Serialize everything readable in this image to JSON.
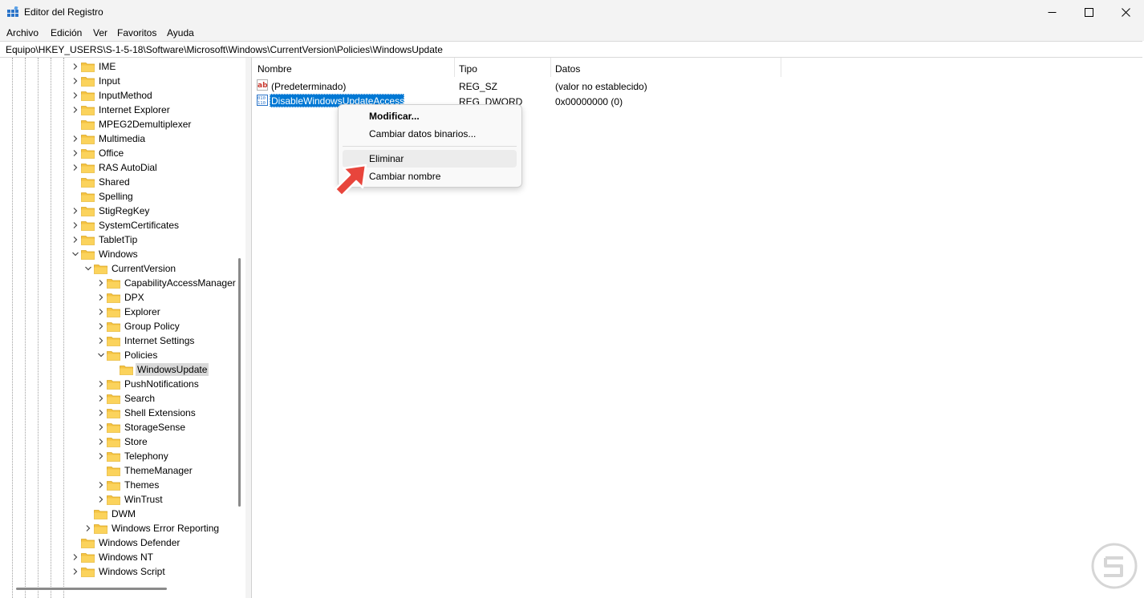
{
  "window": {
    "title": "Editor del Registro",
    "controls": [
      "minimize",
      "maximize",
      "close"
    ]
  },
  "menubar": {
    "items": [
      "Archivo",
      "Edición",
      "Ver",
      "Favoritos",
      "Ayuda"
    ]
  },
  "address": {
    "path": "Equipo\\HKEY_USERS\\S-1-5-18\\Software\\Microsoft\\Windows\\CurrentVersion\\Policies\\WindowsUpdate"
  },
  "tree": {
    "nodes": [
      {
        "label": "IME",
        "level": 0,
        "expander": "collapsed"
      },
      {
        "label": "Input",
        "level": 0,
        "expander": "collapsed"
      },
      {
        "label": "InputMethod",
        "level": 0,
        "expander": "collapsed"
      },
      {
        "label": "Internet Explorer",
        "level": 0,
        "expander": "collapsed"
      },
      {
        "label": "MPEG2Demultiplexer",
        "level": 0,
        "expander": "none"
      },
      {
        "label": "Multimedia",
        "level": 0,
        "expander": "collapsed"
      },
      {
        "label": "Office",
        "level": 0,
        "expander": "collapsed"
      },
      {
        "label": "RAS AutoDial",
        "level": 0,
        "expander": "collapsed"
      },
      {
        "label": "Shared",
        "level": 0,
        "expander": "none"
      },
      {
        "label": "Spelling",
        "level": 0,
        "expander": "none"
      },
      {
        "label": "StigRegKey",
        "level": 0,
        "expander": "collapsed"
      },
      {
        "label": "SystemCertificates",
        "level": 0,
        "expander": "collapsed"
      },
      {
        "label": "TabletTip",
        "level": 0,
        "expander": "collapsed"
      },
      {
        "label": "Windows",
        "level": 0,
        "expander": "expanded"
      },
      {
        "label": "CurrentVersion",
        "level": 1,
        "expander": "expanded"
      },
      {
        "label": "CapabilityAccessManager",
        "level": 2,
        "expander": "collapsed"
      },
      {
        "label": "DPX",
        "level": 2,
        "expander": "collapsed"
      },
      {
        "label": "Explorer",
        "level": 2,
        "expander": "collapsed"
      },
      {
        "label": "Group Policy",
        "level": 2,
        "expander": "collapsed"
      },
      {
        "label": "Internet Settings",
        "level": 2,
        "expander": "collapsed"
      },
      {
        "label": "Policies",
        "level": 2,
        "expander": "expanded"
      },
      {
        "label": "WindowsUpdate",
        "level": 3,
        "expander": "none",
        "selected": true
      },
      {
        "label": "PushNotifications",
        "level": 2,
        "expander": "collapsed"
      },
      {
        "label": "Search",
        "level": 2,
        "expander": "collapsed"
      },
      {
        "label": "Shell Extensions",
        "level": 2,
        "expander": "collapsed"
      },
      {
        "label": "StorageSense",
        "level": 2,
        "expander": "collapsed"
      },
      {
        "label": "Store",
        "level": 2,
        "expander": "collapsed"
      },
      {
        "label": "Telephony",
        "level": 2,
        "expander": "collapsed"
      },
      {
        "label": "ThemeManager",
        "level": 2,
        "expander": "none"
      },
      {
        "label": "Themes",
        "level": 2,
        "expander": "collapsed"
      },
      {
        "label": "WinTrust",
        "level": 2,
        "expander": "collapsed"
      },
      {
        "label": "DWM",
        "level": 1,
        "expander": "none"
      },
      {
        "label": "Windows Error Reporting",
        "level": 1,
        "expander": "collapsed"
      },
      {
        "label": "Windows Defender",
        "level": 0,
        "expander": "none"
      },
      {
        "label": "Windows NT",
        "level": 0,
        "expander": "collapsed"
      },
      {
        "label": "Windows Script",
        "level": 0,
        "expander": "collapsed"
      }
    ]
  },
  "list": {
    "columns": [
      "Nombre",
      "Tipo",
      "Datos"
    ],
    "rows": [
      {
        "icon": "string-value-icon",
        "name": "(Predeterminado)",
        "type": "REG_SZ",
        "data": "(valor no establecido)",
        "selected": false
      },
      {
        "icon": "binary-value-icon",
        "name": "DisableWindowsUpdateAccess",
        "type": "REG_DWORD",
        "data": "0x00000000 (0)",
        "selected": true
      }
    ]
  },
  "context_menu": {
    "items": [
      {
        "label": "Modificar...",
        "bold": true
      },
      {
        "label": "Cambiar datos binarios..."
      },
      {
        "separator": true
      },
      {
        "label": "Eliminar",
        "hovered": true
      },
      {
        "label": "Cambiar nombre"
      }
    ]
  },
  "colors": {
    "selection": "#0078d4",
    "hover": "#ececec",
    "folder": "#f5c342",
    "arrow": "#e8453c"
  },
  "icons": {
    "app": "registry-editor-icon",
    "folder": "folder-icon",
    "arrow": "red-pointer-arrow-icon",
    "watermark": "watermark-logo-icon"
  }
}
